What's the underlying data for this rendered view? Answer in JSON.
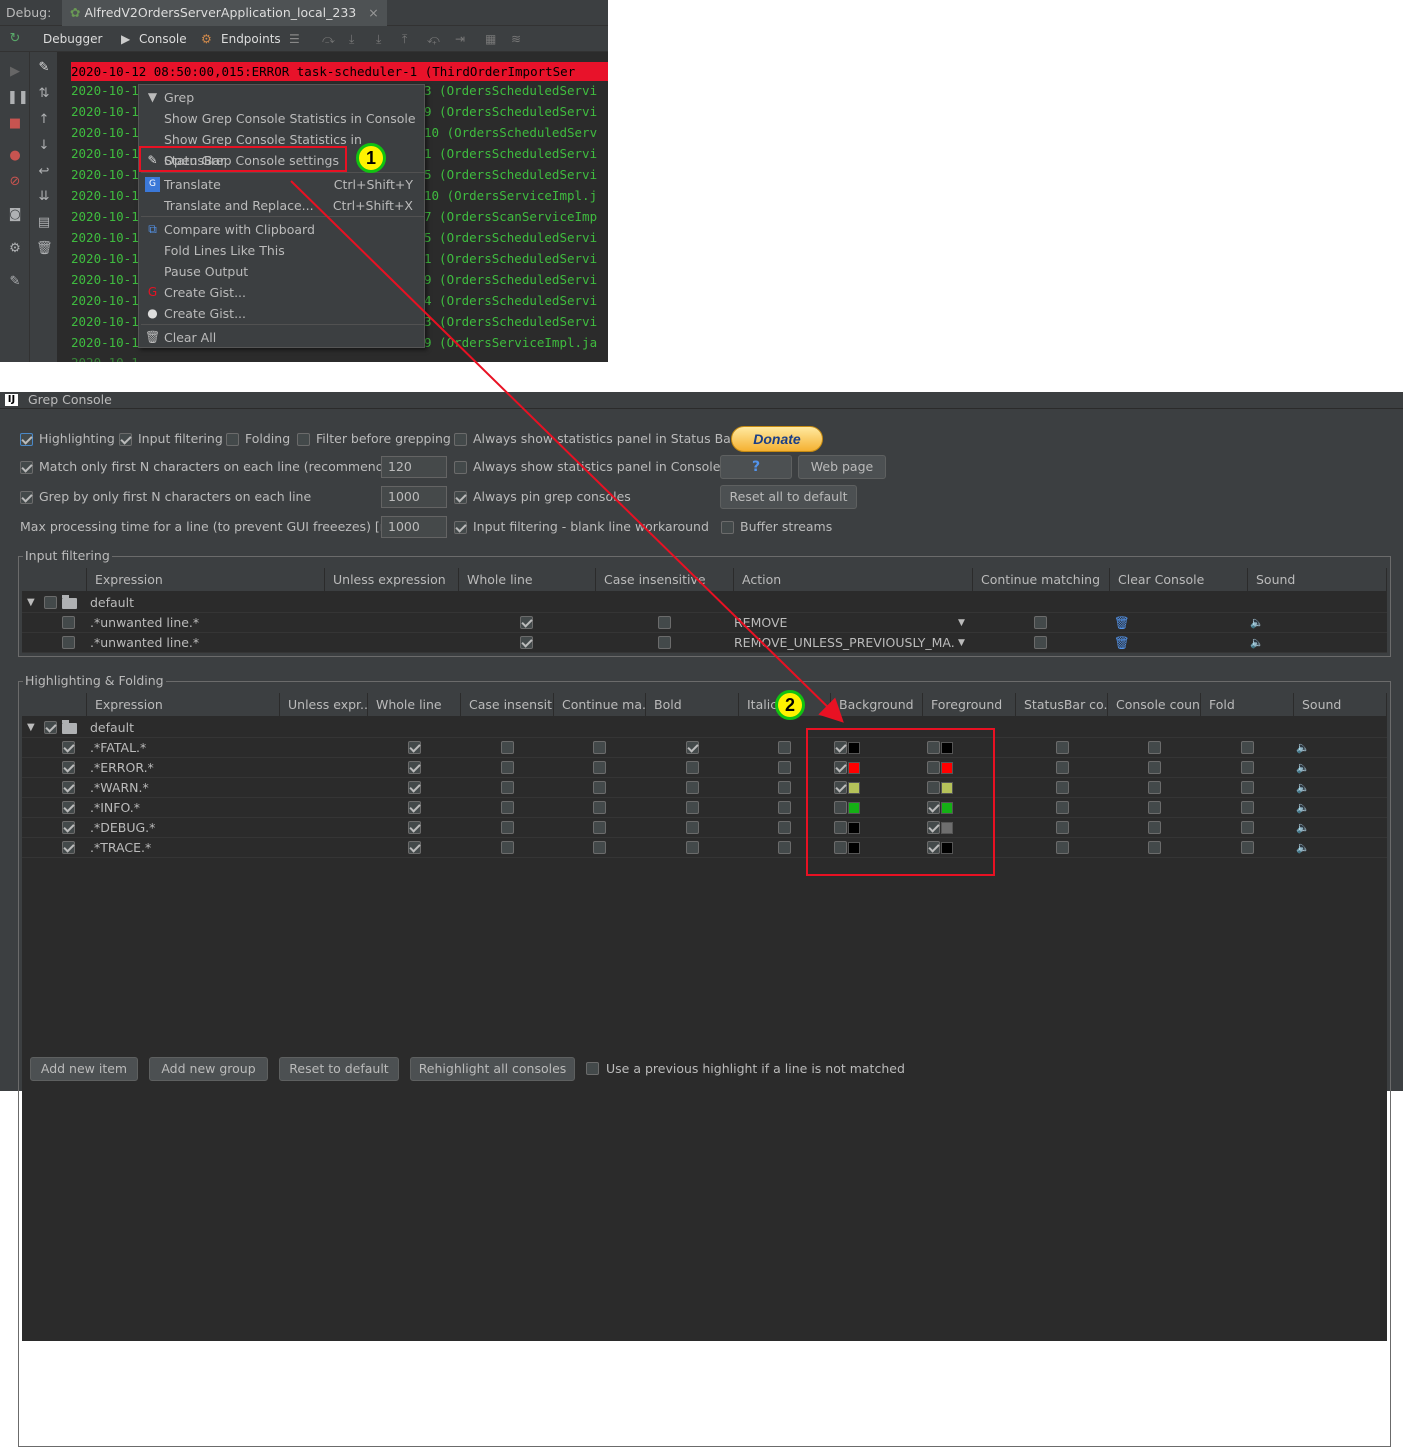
{
  "debug": {
    "label": "Debug:",
    "run_tab": "AlfredV2OrdersServerApplication_local_233",
    "close": "×"
  },
  "toolbar": {
    "debugger": "Debugger",
    "console": "Console",
    "endpoints": "Endpoints"
  },
  "console": {
    "error_line": "2020-10-12 08:50:00,015:ERROR task-scheduler-1 (ThirdOrderImportSer",
    "lines_left": [
      "2020-10-1",
      "2020-10-1",
      "2020-10-1",
      "2020-10-1",
      "2020-10-1",
      "2020-10-1",
      "2020-10-1",
      "2020-10-1",
      "2020-10-1",
      "2020-10-1",
      "2020-10-1",
      "2020-10-1",
      "2020-10-1"
    ],
    "lines_right": [
      "3 (OrdersScheduledServi",
      "9 (OrdersScheduledServi",
      "10 (OrdersScheduledServ",
      "1 (OrdersScheduledServi",
      "5 (OrdersScheduledServi",
      "10 (OrdersServiceImpl.j",
      "7 (OrdersScanServiceImp",
      "5 (OrdersScheduledServi",
      "1 (OrdersScheduledServi",
      "9 (OrdersScheduledServi",
      "4 (OrdersScheduledServi",
      "3 (OrdersScheduledServi",
      "9 (OrdersServiceImpl.ja"
    ]
  },
  "menu": {
    "items": [
      {
        "label": "Grep",
        "shortcut": "",
        "icon": "filter-icon"
      },
      {
        "label": "Show Grep Console Statistics in Console",
        "shortcut": "",
        "icon": ""
      },
      {
        "label": "Show Grep Console Statistics in StatusBar",
        "shortcut": "",
        "icon": ""
      },
      {
        "label": "Open Grep Console settings",
        "shortcut": "",
        "icon": "pencil-icon"
      },
      {
        "label": "Translate",
        "shortcut": "Ctrl+Shift+Y",
        "icon": "translate-icon"
      },
      {
        "label": "Translate and Replace...",
        "shortcut": "Ctrl+Shift+X",
        "icon": ""
      },
      {
        "label": "Compare with Clipboard",
        "shortcut": "",
        "icon": "compare-icon"
      },
      {
        "label": "Fold Lines Like This",
        "shortcut": "",
        "icon": ""
      },
      {
        "label": "Pause Output",
        "shortcut": "",
        "icon": ""
      },
      {
        "label": "Create Gist...",
        "shortcut": "",
        "icon": "gist-icon"
      },
      {
        "label": "Create Gist...",
        "shortcut": "",
        "icon": "github-icon"
      },
      {
        "label": "Clear All",
        "shortcut": "",
        "icon": "trash-icon"
      }
    ]
  },
  "badges": {
    "one": "1",
    "two": "2"
  },
  "dialog": {
    "title": "Grep Console",
    "opts": {
      "highlighting": "Highlighting",
      "input_filtering": "Input filtering",
      "folding": "Folding",
      "filter_before": "Filter before grepping",
      "always_stats_statusbar": "Always show statistics panel in Status Bar",
      "match_first_n": "Match only first N characters on each line (recommended)",
      "match_first_n_val": "120",
      "always_stats_console": "Always show statistics panel in Console",
      "grep_first_n": "Grep by only first N characters on each line",
      "grep_first_n_val": "1000",
      "always_pin": "Always pin grep consoles",
      "max_time": "Max processing time for a line (to prevent GUI freeezes) [ms]",
      "max_time_val": "1000",
      "blank_line": "Input filtering - blank line workaround",
      "buffer": "Buffer streams"
    },
    "buttons": {
      "donate": "Donate",
      "help": "?",
      "web_page": "Web page",
      "reset_all": "Reset all to default"
    },
    "input_filtering": {
      "title": "Input filtering",
      "headers": [
        "Expression",
        "Unless expression",
        "Whole line",
        "Case insensitive",
        "Action",
        "Continue matching",
        "Clear Console",
        "Sound"
      ],
      "group": "default",
      "rows": [
        {
          "expr": ".*unwanted line.*",
          "action": "REMOVE"
        },
        {
          "expr": ".*unwanted line.*",
          "action": "REMOVE_UNLESS_PREVIOUSLY_MA..."
        }
      ]
    },
    "highlighting": {
      "title": "Highlighting & Folding",
      "headers": [
        "Expression",
        "Unless expr...",
        "Whole line",
        "Case insensit...",
        "Continue ma...",
        "Bold",
        "Italic",
        "Background",
        "Foreground",
        "StatusBar co...",
        "Console count",
        "Fold",
        "Sound"
      ],
      "group": "default",
      "rows": [
        {
          "expr": ".*FATAL.*",
          "bold": true,
          "bg_on": true,
          "bg": "#000000",
          "fg_on": false,
          "fg": "#000000"
        },
        {
          "expr": ".*ERROR.*",
          "bold": false,
          "bg_on": true,
          "bg": "#ff0000",
          "fg_on": false,
          "fg": "#ff0000"
        },
        {
          "expr": ".*WARN.*",
          "bold": false,
          "bg_on": true,
          "bg": "#b5c25a",
          "fg_on": false,
          "fg": "#b5c25a"
        },
        {
          "expr": ".*INFO.*",
          "bold": false,
          "bg_on": false,
          "bg": "#15b015",
          "fg_on": true,
          "fg": "#15b015"
        },
        {
          "expr": ".*DEBUG.*",
          "bold": false,
          "bg_on": false,
          "bg": "#000000",
          "fg_on": true,
          "fg": "#6e6e6e"
        },
        {
          "expr": ".*TRACE.*",
          "bold": false,
          "bg_on": false,
          "bg": "#000000",
          "fg_on": true,
          "fg": "#000000"
        }
      ]
    },
    "bottom": {
      "add_item": "Add new item",
      "add_group": "Add new group",
      "reset": "Reset to default",
      "rehighlight": "Rehighlight all consoles",
      "use_previous": "Use a previous highlight if a line is not matched"
    }
  },
  "colors": {
    "highlight_box": "#e81123",
    "arrow": "#e81123",
    "badge_fill": "#fff200",
    "badge_ring": "#11c211"
  }
}
